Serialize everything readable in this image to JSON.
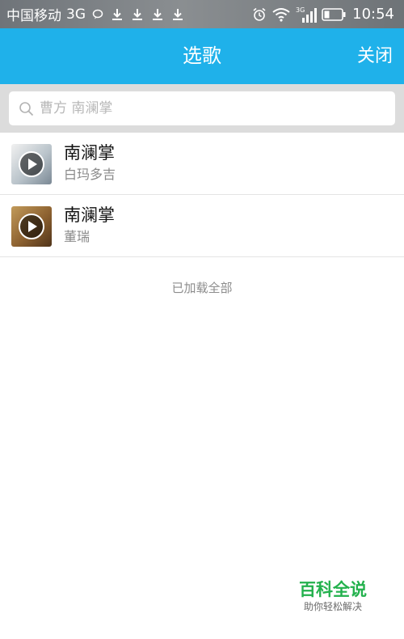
{
  "status_bar": {
    "carrier": "中国移动",
    "network": "3G",
    "signal_label": "3G",
    "time": "10:54",
    "icons": [
      "chat-bubble-icon",
      "download-icon",
      "download-icon",
      "download-icon",
      "download-icon",
      "alarm-icon",
      "wifi-icon",
      "signal-icon",
      "battery-icon"
    ]
  },
  "app_bar": {
    "title": "选歌",
    "close_label": "关闭"
  },
  "search": {
    "placeholder": "曹方 南澜掌",
    "value": ""
  },
  "songs": [
    {
      "title": "南澜掌",
      "artist": "白玛多吉"
    },
    {
      "title": "南澜掌",
      "artist": "董瑞"
    }
  ],
  "footer": {
    "loaded_all": "已加载全部"
  },
  "watermark": {
    "title": "百科全说",
    "subtitle": "助你轻松解决"
  },
  "colors": {
    "app_bar": "#1fb1ea",
    "search_band": "#dcdcdc",
    "watermark_green": "#23b14d"
  }
}
